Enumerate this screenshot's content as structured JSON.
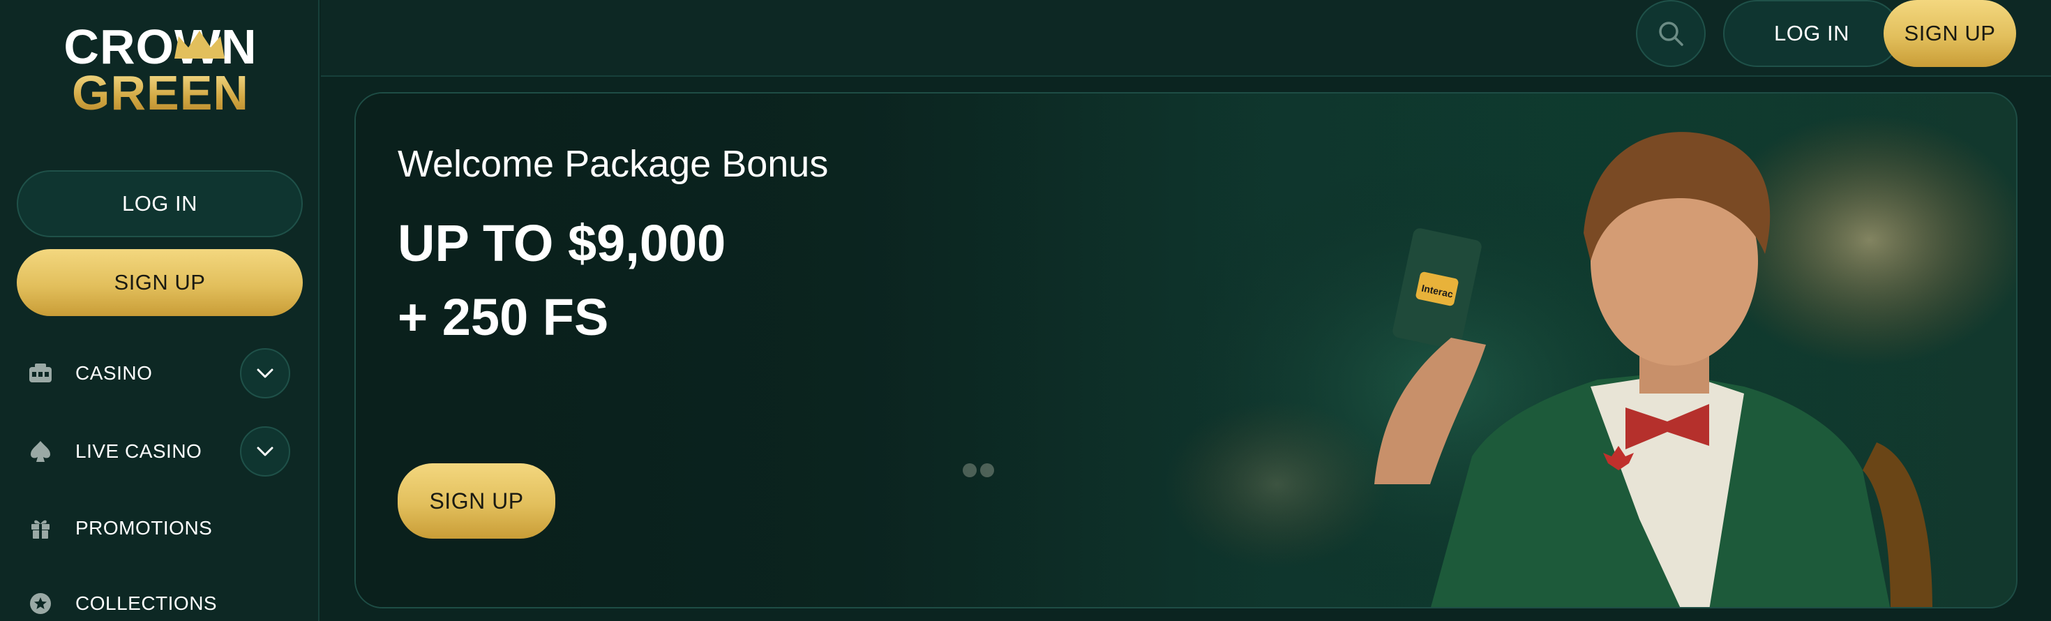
{
  "brand": {
    "line1": "CROWN",
    "line2": "GREEN"
  },
  "sidebar": {
    "login_label": "LOG IN",
    "signup_label": "SIGN UP",
    "items": [
      {
        "label": "CASINO",
        "icon": "slot-machine-icon",
        "expandable": true
      },
      {
        "label": "LIVE CASINO",
        "icon": "spade-icon",
        "expandable": true
      },
      {
        "label": "PROMOTIONS",
        "icon": "gift-icon",
        "expandable": false
      },
      {
        "label": "COLLECTIONS",
        "icon": "star-badge-icon",
        "expandable": false
      }
    ]
  },
  "header": {
    "search_icon": "search-icon",
    "login_label": "LOG IN",
    "signup_label": "SIGN UP"
  },
  "hero": {
    "subtitle": "Welcome Package Bonus",
    "amount": "UP TO $9,000",
    "free_spins": "+ 250 FS",
    "cta_label": "SIGN UP",
    "card_text": "Interac"
  },
  "colors": {
    "background": "#0b2420",
    "panel": "#0d2824",
    "accent_gold": "#e2bf5c",
    "border": "#1f5149"
  }
}
